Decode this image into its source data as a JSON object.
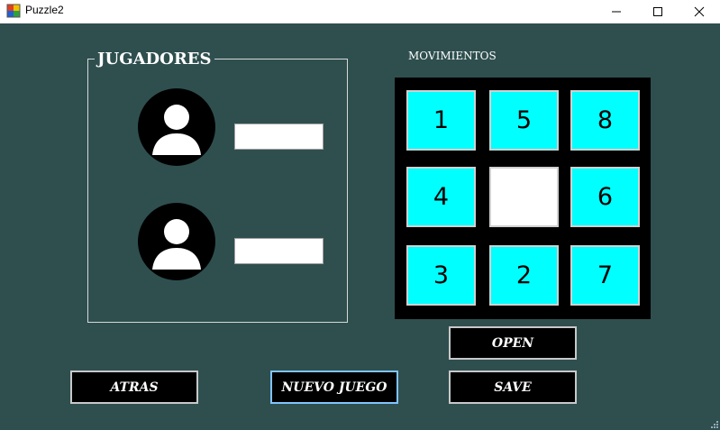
{
  "window": {
    "title": "Puzzle2",
    "app_icon": "app-puzzle-icon",
    "controls": [
      "minimize-icon",
      "maximize-icon",
      "close-icon"
    ]
  },
  "players": {
    "group_title": "JUGADORES",
    "player1": {
      "avatar_icon": "user-avatar-icon",
      "name_value": ""
    },
    "player2": {
      "avatar_icon": "user-avatar-icon",
      "name_value": ""
    }
  },
  "moves": {
    "label": "MOVIMIENTOS"
  },
  "board": {
    "rows": 3,
    "cols": 3,
    "tiles": [
      "1",
      "5",
      "8",
      "4",
      "",
      "6",
      "3",
      "2",
      "7"
    ]
  },
  "buttons": {
    "open": "OPEN",
    "back": "ATRAS",
    "new_game": "NUEVO JUEGO",
    "save": "SAVE"
  },
  "colors": {
    "background": "#2f4f4f",
    "tile": "#00ffff",
    "empty_tile": "#ffffff",
    "board": "#000000",
    "button": "#000000"
  }
}
